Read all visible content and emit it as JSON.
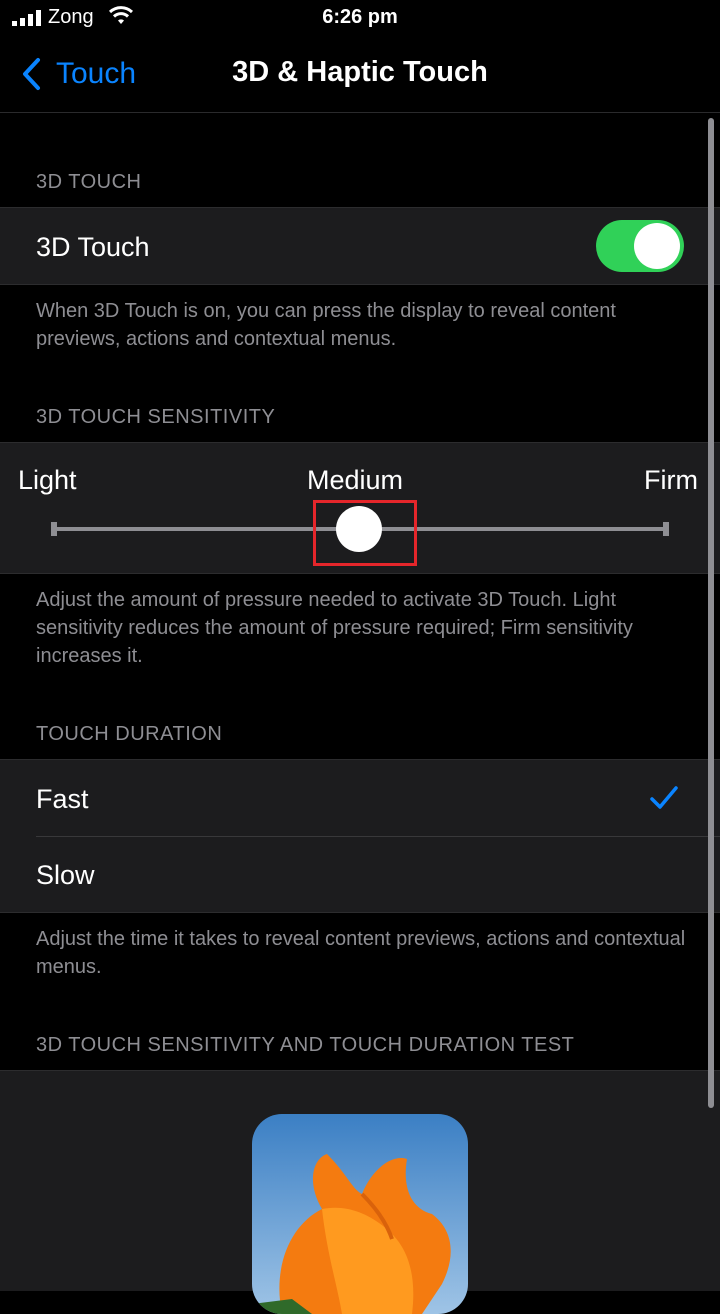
{
  "status": {
    "carrier": "Zong",
    "time": "6:26 pm"
  },
  "nav": {
    "back_label": "Touch",
    "title": "3D & Haptic Touch"
  },
  "sections": {
    "touch_header": "3D TOUCH",
    "touch_label": "3D Touch",
    "touch_toggle_on": true,
    "touch_footer": "When 3D Touch is on, you can press the display to reveal content previews, actions and contextual menus.",
    "sensitivity_header": "3D TOUCH SENSITIVITY",
    "slider": {
      "light": "Light",
      "medium": "Medium",
      "firm": "Firm",
      "value": "Medium",
      "position": 0.5
    },
    "sensitivity_footer": "Adjust the amount of pressure needed to activate 3D Touch. Light sensitivity reduces the amount of pressure required; Firm sensitivity increases it.",
    "duration_header": "TOUCH DURATION",
    "duration_options": [
      "Fast",
      "Slow"
    ],
    "duration_selected": "Fast",
    "duration_footer": "Adjust the time it takes to reveal content previews, actions and contextual menus.",
    "test_header": "3D TOUCH SENSITIVITY AND TOUCH DURATION TEST"
  },
  "colors": {
    "accent": "#0a84ff",
    "toggle_on": "#30d158",
    "highlight": "#e5262b"
  },
  "icons": {
    "back": "chevron-left-icon",
    "check": "checkmark-icon",
    "signal": "cellular-signal-icon",
    "wifi": "wifi-icon"
  }
}
